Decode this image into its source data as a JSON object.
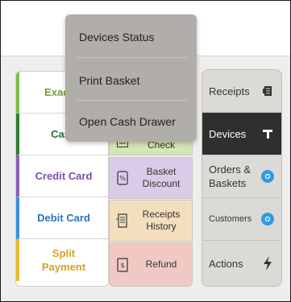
{
  "menu": {
    "items": [
      {
        "label": "Devices Status"
      },
      {
        "label": "Print Basket"
      },
      {
        "label": "Open Cash Drawer"
      }
    ]
  },
  "payments": [
    {
      "label": "Exact C",
      "color": "#6aa533"
    },
    {
      "label": "Cash",
      "color": "#2b6f2d"
    },
    {
      "label": "Credit Card",
      "color": "#7b4fae"
    },
    {
      "label": "Debit Card",
      "color": "#2f74b8"
    },
    {
      "label": "Split Payment",
      "color": "#d9a21c"
    }
  ],
  "middle": [
    {
      "label": "Check",
      "icon": "check-icon"
    },
    {
      "label": "Basket Discount",
      "icon": "discount-tag-icon"
    },
    {
      "label": "Receipts History",
      "icon": "receipts-history-icon"
    },
    {
      "label": "Refund",
      "icon": "refund-icon"
    }
  ],
  "right": [
    {
      "label": "Receipts",
      "icon": "receipt-icon"
    },
    {
      "label": "Devices",
      "icon": "devices-icon",
      "active": true
    },
    {
      "label": "Orders & Baskets",
      "icon": "orders-badge-icon"
    },
    {
      "label": "Customers",
      "icon": "customers-badge-icon"
    },
    {
      "label": "Actions",
      "icon": "lightning-icon"
    }
  ],
  "colors": {
    "menu_bg": "#b1aeaa",
    "active_bg": "#2f2f2f",
    "badge_blue": "#2e9ae6"
  }
}
